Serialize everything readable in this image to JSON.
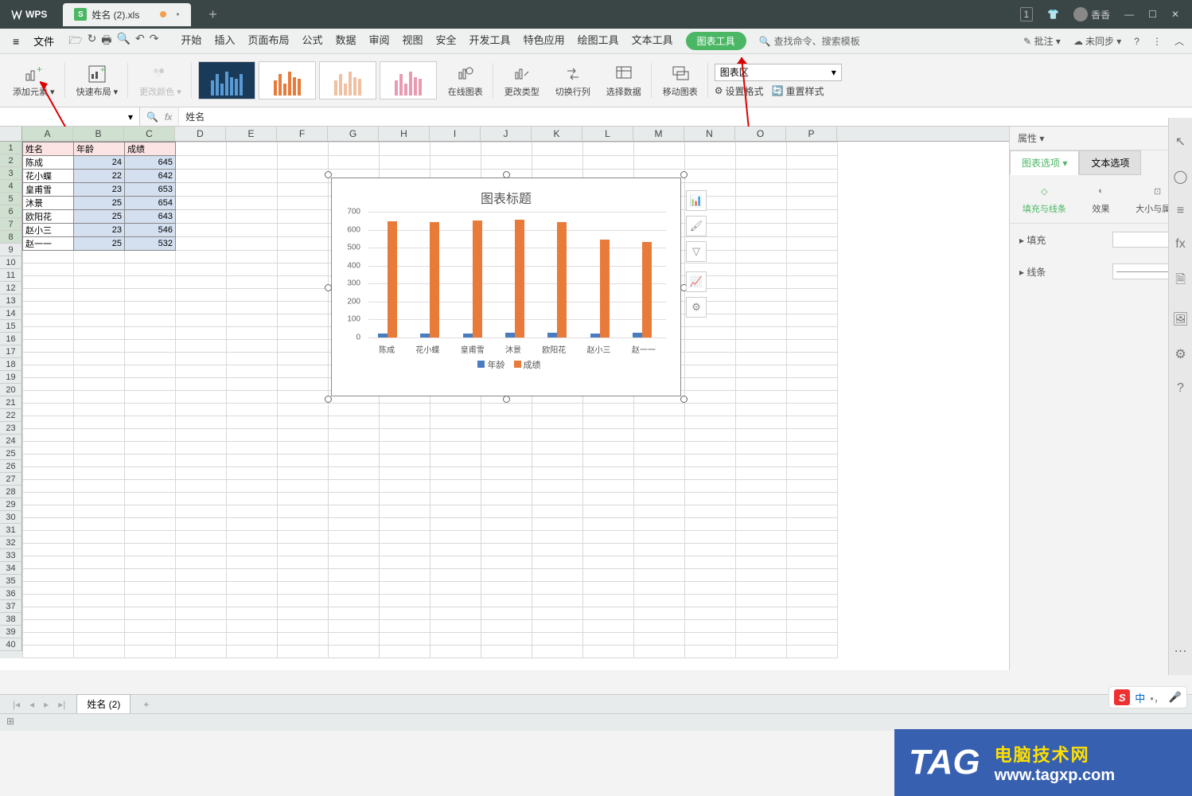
{
  "titlebar": {
    "app_label": "WPS",
    "tab_name": "姓名 (2).xls",
    "user_name": "香香"
  },
  "menubar": {
    "file": "文件",
    "tabs": [
      "开始",
      "插入",
      "页面布局",
      "公式",
      "数据",
      "审阅",
      "视图",
      "安全",
      "开发工具",
      "特色应用",
      "绘图工具",
      "文本工具"
    ],
    "chart_tool": "图表工具",
    "search_placeholder": "查找命令、搜索模板",
    "right": {
      "batch": "批注 ▾",
      "sync": "未同步 ▾"
    }
  },
  "ribbon": {
    "add_element": "添加元素 ▾",
    "quick_layout": "快速布局 ▾",
    "change_color": "更改颜色 ▾",
    "online_chart": "在线图表",
    "change_type": "更改类型",
    "switch_rc": "切换行列",
    "select_data": "选择数据",
    "move_chart": "移动图表",
    "chart_area_select": "图表区",
    "set_format": "设置格式",
    "reset_style": "重置样式"
  },
  "formula": {
    "name_box": "",
    "fx_value": "姓名"
  },
  "table": {
    "headers": [
      "姓名",
      "年龄",
      "成绩"
    ],
    "rows": [
      [
        "陈成",
        "24",
        "645"
      ],
      [
        "花小蝶",
        "22",
        "642"
      ],
      [
        "皇甫雪",
        "23",
        "653"
      ],
      [
        "沐景",
        "25",
        "654"
      ],
      [
        "欧阳花",
        "25",
        "643"
      ],
      [
        "赵小三",
        "23",
        "546"
      ],
      [
        "赵一一",
        "25",
        "532"
      ]
    ]
  },
  "chart_data": {
    "type": "bar",
    "title": "图表标题",
    "categories": [
      "陈成",
      "花小蝶",
      "皇甫雪",
      "沐景",
      "欧阳花",
      "赵小三",
      "赵一一"
    ],
    "series": [
      {
        "name": "年龄",
        "values": [
          24,
          22,
          23,
          25,
          25,
          23,
          25
        ],
        "color": "#4a7dbf"
      },
      {
        "name": "成绩",
        "values": [
          645,
          642,
          653,
          654,
          643,
          546,
          532
        ],
        "color": "#e87a3a"
      }
    ],
    "ylim": [
      0,
      700
    ],
    "ystep": 100,
    "legend": [
      "年龄",
      "成绩"
    ]
  },
  "panel": {
    "title": "属性 ▾",
    "tab_chart": "图表选项 ▾",
    "tab_text": "文本选项",
    "sub_fill": "填充与线条",
    "sub_effect": "效果",
    "sub_size": "大小与属性",
    "fill_label": "▸ 填充",
    "line_label": "▸ 线条"
  },
  "sheet_tab": "姓名 (2)",
  "columns": [
    "A",
    "B",
    "C",
    "D",
    "E",
    "F",
    "G",
    "H",
    "I",
    "J",
    "K",
    "L",
    "M",
    "N",
    "O",
    "P"
  ],
  "watermark": {
    "tag": "TAG",
    "line1": "电脑技术网",
    "line2": "www.tagxp.com"
  },
  "ime": {
    "char": "中"
  }
}
